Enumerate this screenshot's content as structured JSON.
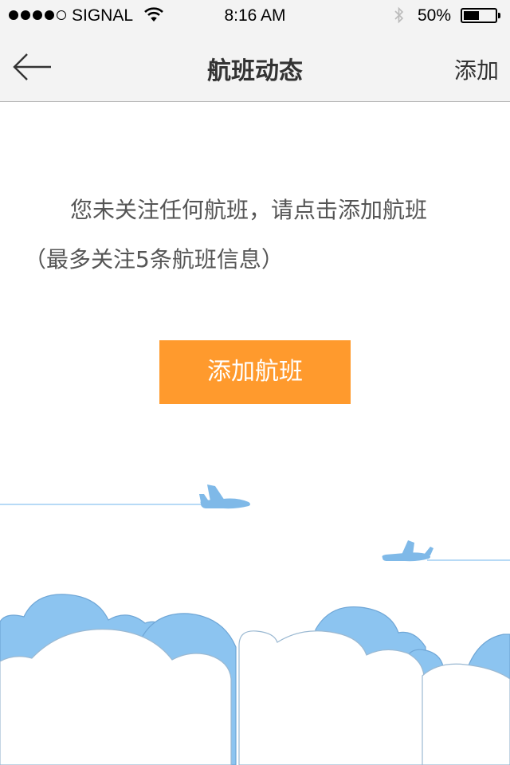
{
  "status_bar": {
    "carrier": "SIGNAL",
    "time": "8:16 AM",
    "battery_percent": "50%",
    "battery_level": 0.5,
    "signal_bars_filled": 4,
    "signal_bars_total": 5,
    "icons": [
      "signal-dots-icon",
      "wifi-icon",
      "bluetooth-icon",
      "battery-icon"
    ]
  },
  "nav": {
    "back_icon": "back-arrow-icon",
    "title": "航班动态",
    "add_label": "添加"
  },
  "message": {
    "line1_prefix": "您未关注任何航班，请点击",
    "line1_link": "添加航班",
    "line2": "（最多关注5条航班信息）"
  },
  "add_button": {
    "label": "添加航班"
  },
  "colors": {
    "accent_orange": "#ff9a2d",
    "sky_blue": "#8cc4f0",
    "plane_blue": "#7fb9e8",
    "bar_gray": "#f3f3f3"
  }
}
